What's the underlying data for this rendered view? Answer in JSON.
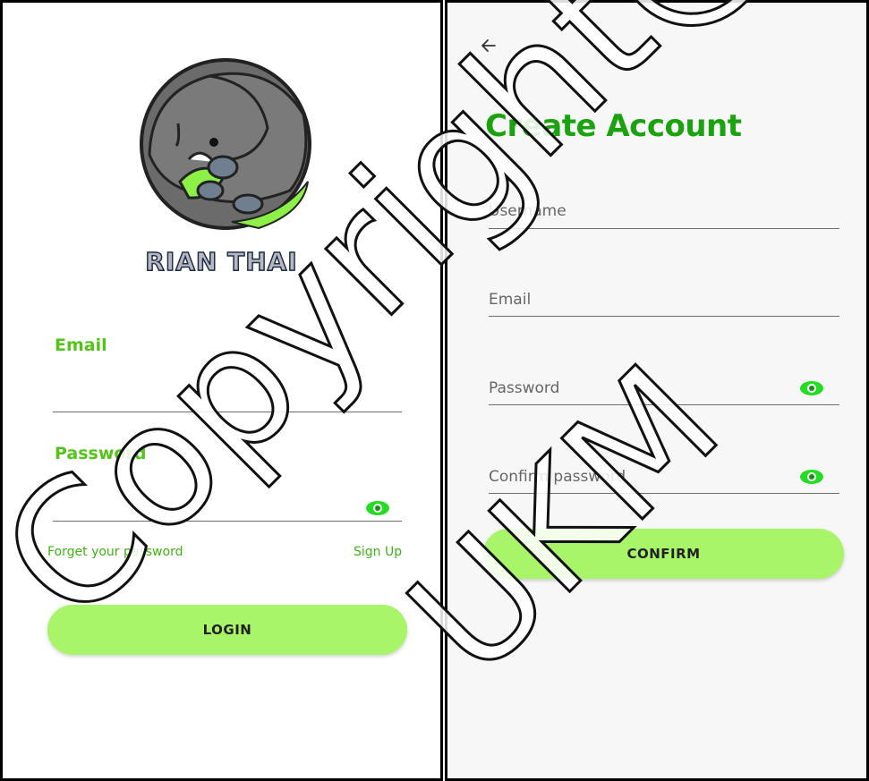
{
  "login": {
    "brand": "RIAN THAI",
    "email_label": "Email",
    "password_label": "Password",
    "forgot_link": "Forget your password",
    "signup_link": "Sign Up",
    "login_button": "LOGIN",
    "icons": {
      "password_visibility": "eye-icon",
      "logo": "elephant-logo"
    }
  },
  "signup": {
    "back_icon": "arrow-left-icon",
    "title": "Create Account",
    "username_placeholder": "Username",
    "email_placeholder": "Email",
    "password_placeholder": "Password",
    "confirm_placeholder": "Confirm password",
    "confirm_button": "CONFIRM"
  },
  "watermark": {
    "line1": "Copyright@FTSM",
    "line2": "UKM"
  },
  "colors": {
    "accent_green": "#55c41a",
    "title_green": "#1aa30f",
    "button_green": "#a8f56a",
    "eye_green": "#22dd22"
  }
}
